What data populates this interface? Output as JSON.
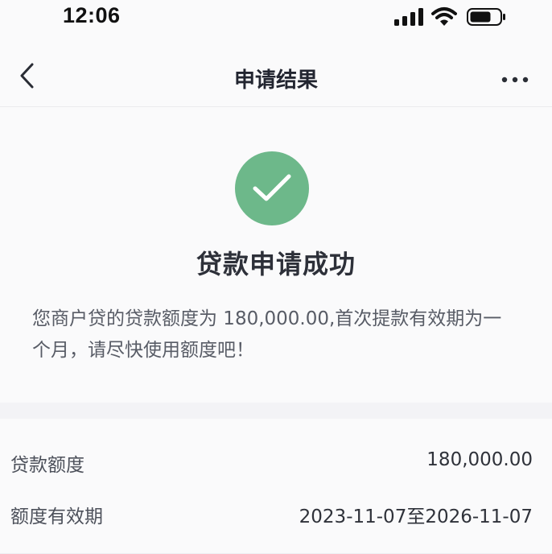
{
  "status_bar": {
    "time": "12:06",
    "icons": [
      "cellular-signal-icon",
      "wifi-icon",
      "battery-icon"
    ]
  },
  "nav": {
    "title": "申请结果",
    "back_icon": "chevron-left-icon",
    "more_icon": "more-horizontal-icon"
  },
  "result": {
    "icon": "check-circle-icon",
    "icon_color": "#6db88a",
    "title": "贷款申请成功",
    "message": "您商户贷的贷款额度为 180,000.00,首次提款有效期为一个月，请尽快使用额度吧！"
  },
  "details": {
    "rows": [
      {
        "label": "贷款额度",
        "value": "180,000.00"
      },
      {
        "label": "额度有效期",
        "value": "2023-11-07至2026-11-07"
      }
    ]
  },
  "colors": {
    "background": "#fafafb",
    "success_green": "#6db88a",
    "title_text": "#2d3039",
    "body_text": "#585c66"
  }
}
